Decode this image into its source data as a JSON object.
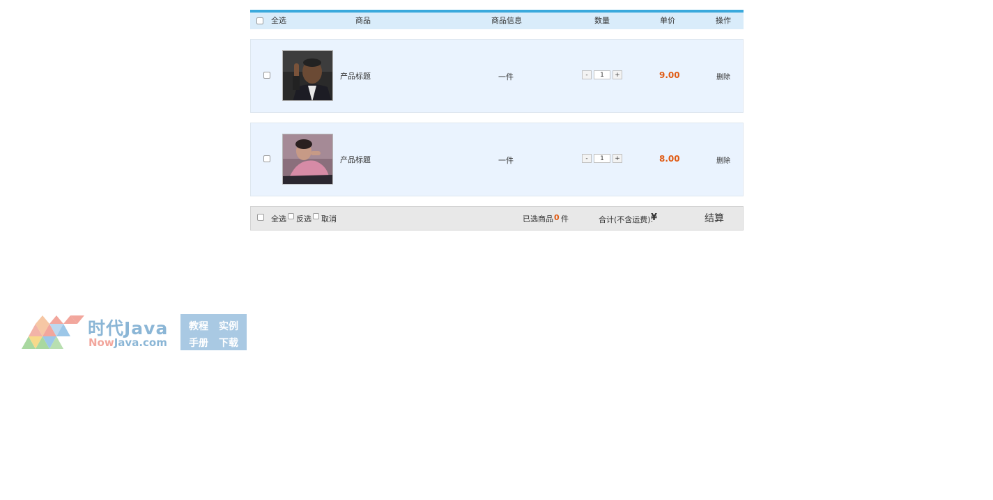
{
  "header": {
    "select_all": "全选",
    "product": "商品",
    "product_info": "商品信息",
    "quantity": "数量",
    "unit_price": "单价",
    "action": "操作"
  },
  "items": [
    {
      "title": "产品标题",
      "info": "一件",
      "quantity": "1",
      "price": "9.00",
      "delete": "删除",
      "minus": "-",
      "plus": "+"
    },
    {
      "title": "产品标题",
      "info": "一件",
      "quantity": "1",
      "price": "8.00",
      "delete": "删除",
      "minus": "-",
      "plus": "+"
    }
  ],
  "footer": {
    "select_all": "全选",
    "invert": "反选",
    "cancel": "取消",
    "selected_label": "已选商品",
    "selected_count": "0",
    "selected_unit": "件",
    "total_label": "合计(不含运费):",
    "currency": "¥",
    "checkout": "结算"
  },
  "watermark": {
    "brand_cn": "时代Java",
    "brand_en_now": "Now",
    "brand_en_rest": "Java.com",
    "tag1": "教程",
    "tag2": "实例",
    "tag3": "手册",
    "tag4": "下载"
  },
  "colors": {
    "header_bg": "#d9ecfa",
    "header_accent": "#3aa9dc",
    "row_bg": "#eaf3fe",
    "price": "#e05b14",
    "footer_bg": "#e8e8e8"
  }
}
